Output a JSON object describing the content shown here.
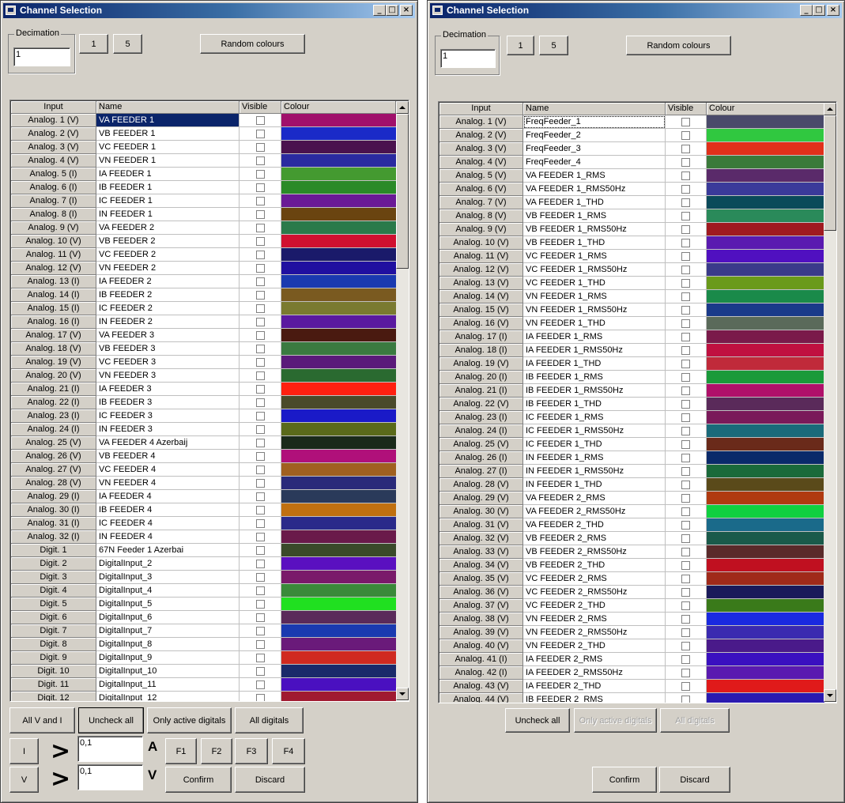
{
  "left": {
    "title": "Channel Selection",
    "decimation_label": "Decimation",
    "decimation_value": "1",
    "btn_1": "1",
    "btn_5": "5",
    "random_colours": "Random colours",
    "headers": [
      "Input",
      "Name",
      "Visible",
      "Colour"
    ],
    "rows": [
      {
        "input": "Analog. 1 (V)",
        "name": "VA FEEDER 1",
        "color": "#a0106b"
      },
      {
        "input": "Analog. 2 (V)",
        "name": "VB FEEDER 1",
        "color": "#1a2ac8"
      },
      {
        "input": "Analog. 3 (V)",
        "name": "VC FEEDER 1",
        "color": "#4a124e"
      },
      {
        "input": "Analog. 4 (V)",
        "name": "VN FEEDER 1",
        "color": "#2a2aa0"
      },
      {
        "input": "Analog. 5 (I)",
        "name": "IA FEEDER 1",
        "color": "#449a30"
      },
      {
        "input": "Analog. 6 (I)",
        "name": "IB FEEDER 1",
        "color": "#2a8a28"
      },
      {
        "input": "Analog. 7 (I)",
        "name": "IC FEEDER 1",
        "color": "#6a1a96"
      },
      {
        "input": "Analog. 8 (I)",
        "name": "IN FEEDER 1",
        "color": "#6a4410"
      },
      {
        "input": "Analog. 9 (V)",
        "name": "VA FEEDER 2",
        "color": "#2a7a4a"
      },
      {
        "input": "Analog. 10 (V)",
        "name": "VB FEEDER 2",
        "color": "#d01030"
      },
      {
        "input": "Analog. 11 (V)",
        "name": "VC FEEDER 2",
        "color": "#1a1a6a"
      },
      {
        "input": "Analog. 12 (V)",
        "name": "VN FEEDER 2",
        "color": "#2010a0"
      },
      {
        "input": "Analog. 13 (I)",
        "name": "IA FEEDER 2",
        "color": "#1a3ab0"
      },
      {
        "input": "Analog. 14 (I)",
        "name": "IB FEEDER 2",
        "color": "#7a5a20"
      },
      {
        "input": "Analog. 15 (I)",
        "name": "IC FEEDER 2",
        "color": "#7a7a30"
      },
      {
        "input": "Analog. 16 (I)",
        "name": "IN FEEDER 2",
        "color": "#5a1aa0"
      },
      {
        "input": "Analog. 17 (V)",
        "name": "VA FEEDER 3",
        "color": "#4a1a10"
      },
      {
        "input": "Analog. 18 (V)",
        "name": "VB FEEDER 3",
        "color": "#3a7a40"
      },
      {
        "input": "Analog. 19 (V)",
        "name": "VC FEEDER 3",
        "color": "#5a1a7a"
      },
      {
        "input": "Analog. 20 (V)",
        "name": "VN FEEDER 3",
        "color": "#2a6a30"
      },
      {
        "input": "Analog. 21 (I)",
        "name": "IA FEEDER 3",
        "color": "#ff2010"
      },
      {
        "input": "Analog. 22 (I)",
        "name": "IB FEEDER 3",
        "color": "#4a4a2a"
      },
      {
        "input": "Analog. 23 (I)",
        "name": "IC FEEDER 3",
        "color": "#1a1ac8"
      },
      {
        "input": "Analog. 24 (I)",
        "name": "IN FEEDER 3",
        "color": "#5a6a1a"
      },
      {
        "input": "Analog. 25 (V)",
        "name": "VA FEEDER 4 Azerbaij",
        "color": "#1a2a1a"
      },
      {
        "input": "Analog. 26 (V)",
        "name": "VB FEEDER 4",
        "color": "#b0107a"
      },
      {
        "input": "Analog. 27 (V)",
        "name": "VC FEEDER 4",
        "color": "#a06020"
      },
      {
        "input": "Analog. 28 (V)",
        "name": "VN FEEDER 4",
        "color": "#2a2a7a"
      },
      {
        "input": "Analog. 29 (I)",
        "name": "IA FEEDER 4",
        "color": "#2a3a5a"
      },
      {
        "input": "Analog. 30 (I)",
        "name": "IB FEEDER 4",
        "color": "#c07010"
      },
      {
        "input": "Analog. 31 (I)",
        "name": "IC FEEDER 4",
        "color": "#2a2a8a"
      },
      {
        "input": "Analog. 32 (I)",
        "name": "IN FEEDER 4",
        "color": "#6a1a4a"
      },
      {
        "input": "Digit. 1",
        "name": "67N Feeder 1 Azerbai",
        "color": "#3a4a2a"
      },
      {
        "input": "Digit. 2",
        "name": "DigitalInput_2",
        "color": "#5a10c0"
      },
      {
        "input": "Digit. 3",
        "name": "DigitalInput_3",
        "color": "#7a1a6a"
      },
      {
        "input": "Digit. 4",
        "name": "DigitalInput_4",
        "color": "#3a8a3a"
      },
      {
        "input": "Digit. 5",
        "name": "DigitalInput_5",
        "color": "#20e020"
      },
      {
        "input": "Digit. 6",
        "name": "DigitalInput_6",
        "color": "#5a2a5a"
      },
      {
        "input": "Digit. 7",
        "name": "DigitalInput_7",
        "color": "#1a3ab0"
      },
      {
        "input": "Digit. 8",
        "name": "DigitalInput_8",
        "color": "#6a1a7a"
      },
      {
        "input": "Digit. 9",
        "name": "DigitalInput_9",
        "color": "#d02a20"
      },
      {
        "input": "Digit. 10",
        "name": "DigitalInput_10",
        "color": "#1a2a6a"
      },
      {
        "input": "Digit. 11",
        "name": "DigitalInput_11",
        "color": "#4a10c0"
      },
      {
        "input": "Digit. 12",
        "name": "DigitalInput_12",
        "color": "#a01a30"
      }
    ],
    "btn_all_v_i": "All V and I",
    "btn_uncheck_all": "Uncheck all",
    "btn_only_active": "Only active digitals",
    "btn_all_digitals": "All digitals",
    "btn_i": "I",
    "btn_v": "V",
    "gt_symbol": ">",
    "i_threshold": "0,1",
    "v_threshold": "0,1",
    "unit_a": "A",
    "unit_v": "V",
    "btn_f1": "F1",
    "btn_f2": "F2",
    "btn_f3": "F3",
    "btn_f4": "F4",
    "btn_confirm": "Confirm",
    "btn_discard": "Discard"
  },
  "right": {
    "title": "Channel Selection",
    "decimation_label": "Decimation",
    "decimation_value": "1",
    "btn_1": "1",
    "btn_5": "5",
    "random_colours": "Random colours",
    "headers": [
      "Input",
      "Name",
      "Visible",
      "Colour"
    ],
    "rows": [
      {
        "input": "Analog. 1 (V)",
        "name": "FreqFeeder_1",
        "color": "#4a4a6a"
      },
      {
        "input": "Analog. 2 (V)",
        "name": "FreqFeeder_2",
        "color": "#30c840"
      },
      {
        "input": "Analog. 3 (V)",
        "name": "FreqFeeder_3",
        "color": "#e0301a"
      },
      {
        "input": "Analog. 4 (V)",
        "name": "FreqFeeder_4",
        "color": "#3a7a3a"
      },
      {
        "input": "Analog. 5 (V)",
        "name": "VA FEEDER 1_RMS",
        "color": "#5a2a6a"
      },
      {
        "input": "Analog. 6 (V)",
        "name": "VA FEEDER 1_RMS50Hz",
        "color": "#3a3a9a"
      },
      {
        "input": "Analog. 7 (V)",
        "name": "VA FEEDER 1_THD",
        "color": "#0a4a5a"
      },
      {
        "input": "Analog. 8 (V)",
        "name": "VB FEEDER 1_RMS",
        "color": "#2a8a5a"
      },
      {
        "input": "Analog. 9 (V)",
        "name": "VB FEEDER 1_RMS50Hz",
        "color": "#a01a20"
      },
      {
        "input": "Analog. 10 (V)",
        "name": "VB FEEDER 1_THD",
        "color": "#5a1ab0"
      },
      {
        "input": "Analog. 11 (V)",
        "name": "VC FEEDER 1_RMS",
        "color": "#5010c0"
      },
      {
        "input": "Analog. 12 (V)",
        "name": "VC FEEDER 1_RMS50Hz",
        "color": "#3a3a8a"
      },
      {
        "input": "Analog. 13 (V)",
        "name": "VC FEEDER 1_THD",
        "color": "#6a9a1a"
      },
      {
        "input": "Analog. 14 (V)",
        "name": "VN FEEDER 1_RMS",
        "color": "#1a8a4a"
      },
      {
        "input": "Analog. 15 (V)",
        "name": "VN FEEDER 1_RMS50Hz",
        "color": "#1a3a8a"
      },
      {
        "input": "Analog. 16 (V)",
        "name": "VN FEEDER 1_THD",
        "color": "#5a6a5a"
      },
      {
        "input": "Analog. 17 (I)",
        "name": "IA FEEDER 1_RMS",
        "color": "#7a1a4a"
      },
      {
        "input": "Analog. 18 (I)",
        "name": "IA FEEDER 1_RMS50Hz",
        "color": "#c01040"
      },
      {
        "input": "Analog. 19 (V)",
        "name": "IA FEEDER 1_THD",
        "color": "#c02a3a"
      },
      {
        "input": "Analog. 20 (I)",
        "name": "IB FEEDER 1_RMS",
        "color": "#1a9a3a"
      },
      {
        "input": "Analog. 21 (I)",
        "name": "IB FEEDER 1_RMS50Hz",
        "color": "#b0106a"
      },
      {
        "input": "Analog. 22 (V)",
        "name": "IB FEEDER 1_THD",
        "color": "#5a2a5a"
      },
      {
        "input": "Analog. 23 (I)",
        "name": "IC FEEDER 1_RMS",
        "color": "#7a1a5a"
      },
      {
        "input": "Analog. 24 (I)",
        "name": "IC FEEDER 1_RMS50Hz",
        "color": "#1a6a7a"
      },
      {
        "input": "Analog. 25 (V)",
        "name": "IC FEEDER 1_THD",
        "color": "#6a2a1a"
      },
      {
        "input": "Analog. 26 (I)",
        "name": "IN FEEDER 1_RMS",
        "color": "#0a2a6a"
      },
      {
        "input": "Analog. 27 (I)",
        "name": "IN FEEDER 1_RMS50Hz",
        "color": "#1a6a3a"
      },
      {
        "input": "Analog. 28 (V)",
        "name": "IN FEEDER 1_THD",
        "color": "#5a4a1a"
      },
      {
        "input": "Analog. 29 (V)",
        "name": "VA FEEDER 2_RMS",
        "color": "#b03a10"
      },
      {
        "input": "Analog. 30 (V)",
        "name": "VA FEEDER 2_RMS50Hz",
        "color": "#10d040"
      },
      {
        "input": "Analog. 31 (V)",
        "name": "VA FEEDER 2_THD",
        "color": "#1a6a8a"
      },
      {
        "input": "Analog. 32 (V)",
        "name": "VB FEEDER 2_RMS",
        "color": "#1a5a4a"
      },
      {
        "input": "Analog. 33 (V)",
        "name": "VB FEEDER 2_RMS50Hz",
        "color": "#5a2a2a"
      },
      {
        "input": "Analog. 34 (V)",
        "name": "VB FEEDER 2_THD",
        "color": "#c01020"
      },
      {
        "input": "Analog. 35 (V)",
        "name": "VC FEEDER 2_RMS",
        "color": "#a02a1a"
      },
      {
        "input": "Analog. 36 (V)",
        "name": "VC FEEDER 2_RMS50Hz",
        "color": "#1a1a5a"
      },
      {
        "input": "Analog. 37 (V)",
        "name": "VC FEEDER 2_THD",
        "color": "#3a7a1a"
      },
      {
        "input": "Analog. 38 (V)",
        "name": "VN FEEDER 2_RMS",
        "color": "#1a2ae0"
      },
      {
        "input": "Analog. 39 (V)",
        "name": "VN FEEDER 2_RMS50Hz",
        "color": "#3a2ab0"
      },
      {
        "input": "Analog. 40 (V)",
        "name": "VN FEEDER 2_THD",
        "color": "#4a1a8a"
      },
      {
        "input": "Analog. 41 (I)",
        "name": "IA FEEDER 2_RMS",
        "color": "#3a10c0"
      },
      {
        "input": "Analog. 42 (I)",
        "name": "IA FEEDER 2_RMS50Hz",
        "color": "#5a1ab0"
      },
      {
        "input": "Analog. 43 (V)",
        "name": "IA FEEDER 2_THD",
        "color": "#e01a1a"
      },
      {
        "input": "Analog. 44 (V)",
        "name": "IB FEEDER 2_RMS",
        "color": "#2a1ab0"
      }
    ],
    "btn_uncheck_all": "Uncheck all",
    "btn_only_active": "Only active digitals",
    "btn_all_digitals": "All digitals",
    "btn_confirm": "Confirm",
    "btn_discard": "Discard"
  }
}
